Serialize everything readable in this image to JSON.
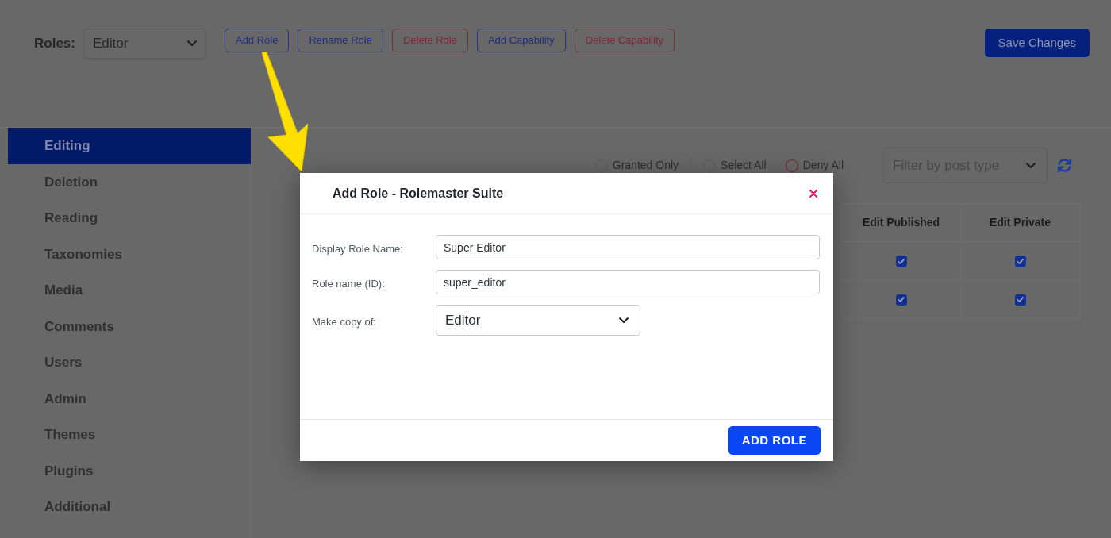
{
  "toolbar": {
    "roles_label": "Roles:",
    "roles_select": {
      "value": "Editor"
    },
    "buttons": [
      {
        "label": "Add Role",
        "kind": "primary"
      },
      {
        "label": "Rename Role",
        "kind": "primary"
      },
      {
        "label": "Delete Role",
        "kind": "danger"
      },
      {
        "label": "Add Capability",
        "kind": "primary"
      },
      {
        "label": "Delete Capability",
        "kind": "danger"
      }
    ],
    "save_button": "Save Changes"
  },
  "sidebar": {
    "items": [
      {
        "label": "Editing",
        "selected": true
      },
      {
        "label": "Deletion",
        "selected": false
      },
      {
        "label": "Reading",
        "selected": false
      },
      {
        "label": "Taxonomies",
        "selected": false
      },
      {
        "label": "Media",
        "selected": false
      },
      {
        "label": "Comments",
        "selected": false
      },
      {
        "label": "Users",
        "selected": false
      },
      {
        "label": "Admin",
        "selected": false
      },
      {
        "label": "Themes",
        "selected": false
      },
      {
        "label": "Plugins",
        "selected": false
      },
      {
        "label": "Additional",
        "selected": false
      }
    ]
  },
  "filters": {
    "radios": [
      {
        "label": "Granted Only",
        "kind": "neutral",
        "selected": false
      },
      {
        "label": "Select All",
        "kind": "neutral",
        "selected": false
      },
      {
        "label": "Deny All",
        "kind": "danger",
        "selected": false
      }
    ],
    "post_type_select": {
      "placeholder": "Filter by post type"
    }
  },
  "table": {
    "columns": [
      "Edit Published",
      "Edit Private"
    ],
    "rows": [
      {
        "cells": [
          {
            "checked": true
          },
          {
            "checked": true
          }
        ]
      },
      {
        "cells": [
          {
            "checked": true
          },
          {
            "checked": true
          }
        ]
      }
    ]
  },
  "modal": {
    "title": "Add Role - Rolemaster Suite",
    "fields": [
      {
        "label": "Display Role Name:",
        "kind": "text",
        "value": "Super Editor"
      },
      {
        "label": "Role name (ID):",
        "kind": "text",
        "value": "super_editor"
      },
      {
        "label": "Make copy of:",
        "kind": "select",
        "value": "Editor"
      }
    ],
    "submit_button": "ADD ROLE"
  }
}
